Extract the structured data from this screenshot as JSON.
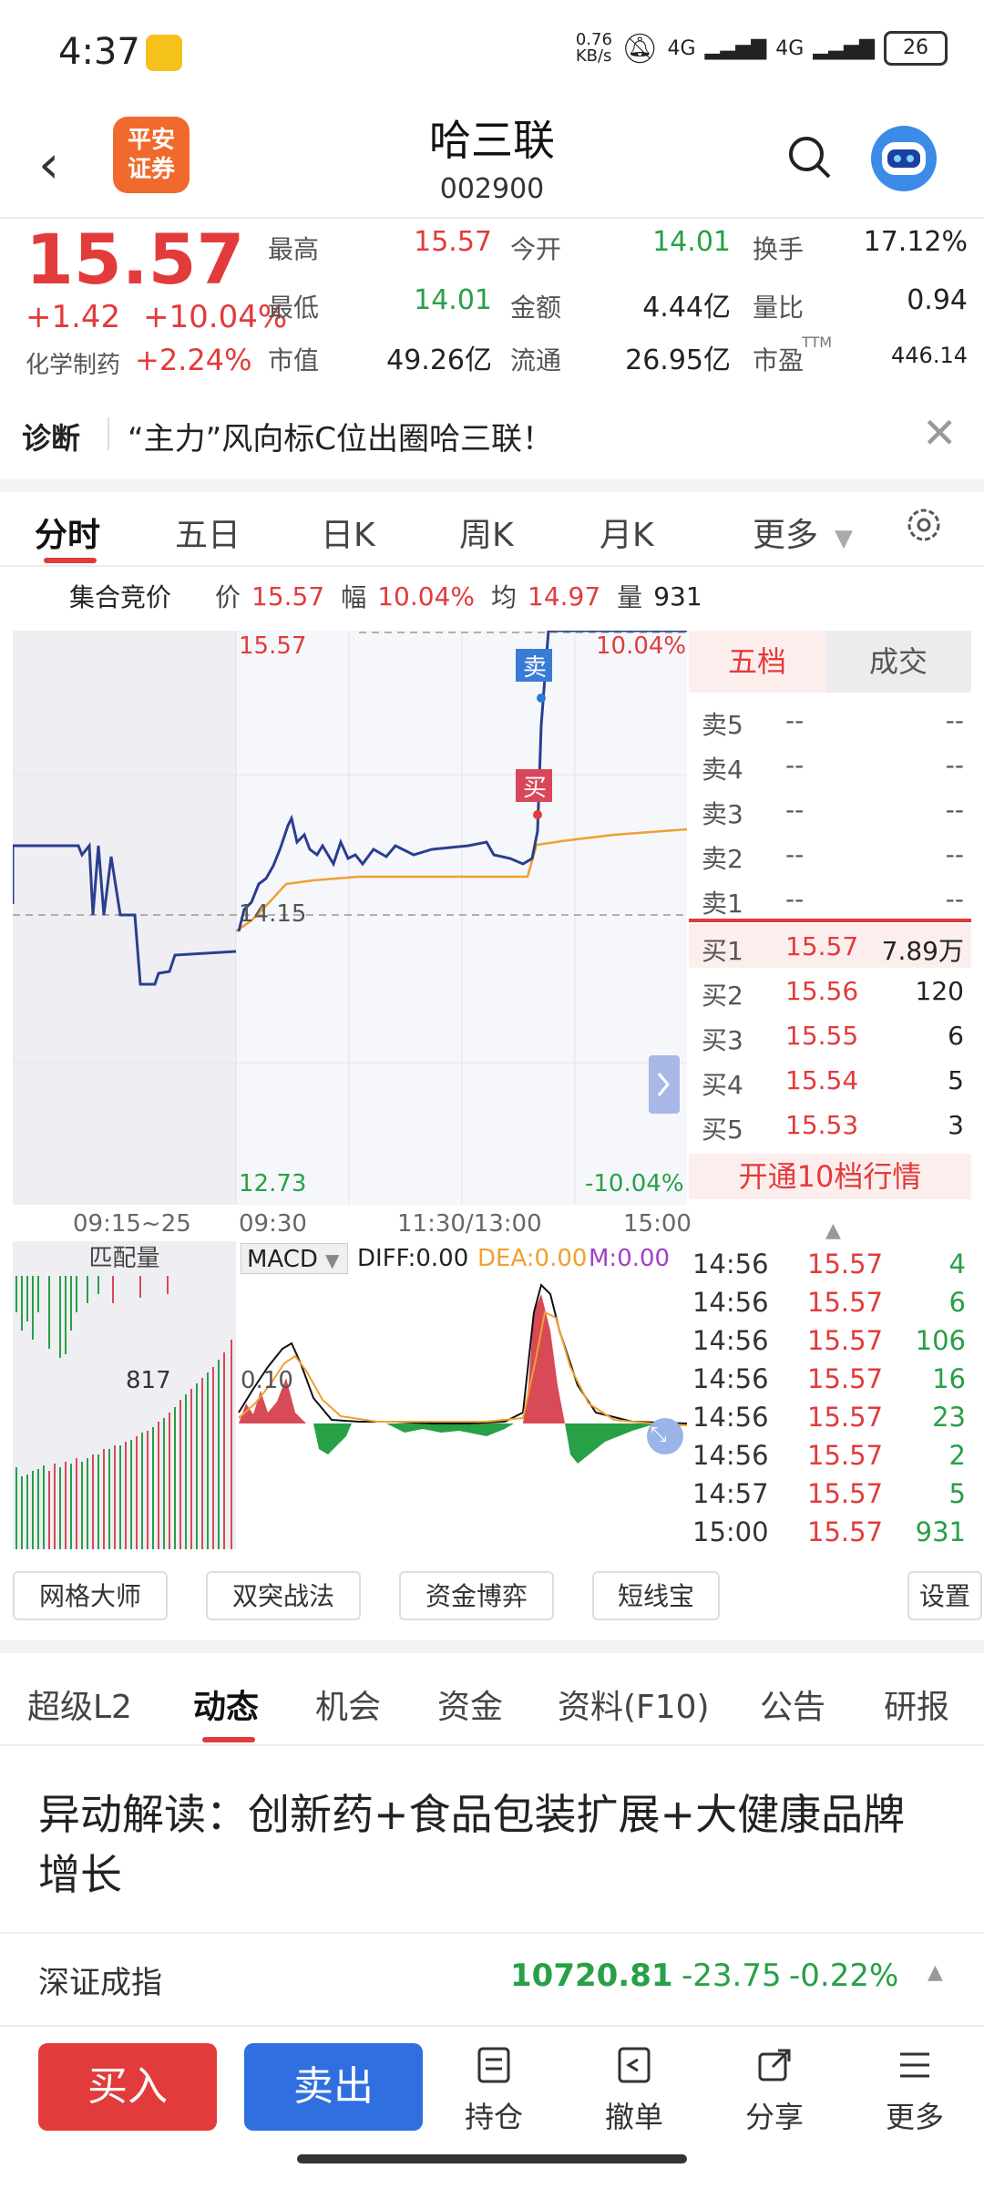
{
  "status_bar": {
    "time": "4:37",
    "speed": "0.76\nKB/s",
    "net1": "4G",
    "net2": "4G",
    "battery": "26"
  },
  "header": {
    "back": "‹",
    "logo_line1": "平安",
    "logo_line2": "证券",
    "name": "哈三联",
    "code": "002900"
  },
  "quote": {
    "price": "15.57",
    "change": "+1.42",
    "change_pct": "+10.04%",
    "sector": "化学制药",
    "sector_pct": "+2.24%",
    "cells": [
      {
        "label": "最高",
        "value": "15.57",
        "color": "#e23b3b"
      },
      {
        "label": "今开",
        "value": "14.01",
        "color": "#27a046"
      },
      {
        "label": "换手",
        "value": "17.12%",
        "color": "#222222"
      },
      {
        "label": "最低",
        "value": "14.01",
        "color": "#27a046"
      },
      {
        "label": "金额",
        "value": "4.44亿",
        "color": "#222222"
      },
      {
        "label": "量比",
        "value": "0.94",
        "color": "#222222"
      },
      {
        "label": "市值",
        "value": "49.26亿",
        "color": "#222222"
      },
      {
        "label": "流通",
        "value": "26.95亿",
        "color": "#222222"
      },
      {
        "label": "市盈",
        "value": "446.14",
        "color": "#222222"
      }
    ],
    "ttm": "TTM"
  },
  "diagnosis": {
    "label": "诊断",
    "text": "“主力”风向标C位出圈哈三联！",
    "close": "✕"
  },
  "tabs": {
    "items": [
      "分时",
      "五日",
      "日K",
      "周K",
      "月K",
      "更多"
    ],
    "active": "分时"
  },
  "info_strip": {
    "auction": "集合竞价",
    "p_label": "价",
    "p": "15.57",
    "f_label": "幅",
    "f": "10.04%",
    "avg_label": "均",
    "avg": "14.97",
    "vol_label": "量",
    "vol": "931"
  },
  "chart": {
    "high_label": "15.57",
    "high_pct": "10.04%",
    "mid_label": "14.15",
    "low_label": "12.73",
    "low_pct": "-10.04%",
    "sell_marker": "卖",
    "buy_marker": "买",
    "time_axis": [
      "09:15~25",
      "09:30",
      "11:30/13:00",
      "15:00"
    ],
    "match_label": "匹配量",
    "match_value": "817",
    "macd": {
      "indicator": "MACD",
      "diff": "DIFF:0.00",
      "dea": "DEA:0.00",
      "m": "M:0.00",
      "level": "0.10"
    }
  },
  "order_book": {
    "tab_left": "五档",
    "tab_right": "成交",
    "asks": [
      {
        "label": "卖5",
        "price": "--",
        "vol": "--"
      },
      {
        "label": "卖4",
        "price": "--",
        "vol": "--"
      },
      {
        "label": "卖3",
        "price": "--",
        "vol": "--"
      },
      {
        "label": "卖2",
        "price": "--",
        "vol": "--"
      },
      {
        "label": "卖1",
        "price": "--",
        "vol": "--"
      }
    ],
    "bids": [
      {
        "label": "买1",
        "price": "15.57",
        "vol": "7.89万"
      },
      {
        "label": "买2",
        "price": "15.56",
        "vol": "120"
      },
      {
        "label": "买3",
        "price": "15.55",
        "vol": "6"
      },
      {
        "label": "买4",
        "price": "15.54",
        "vol": "5"
      },
      {
        "label": "买5",
        "price": "15.53",
        "vol": "3"
      }
    ],
    "promo": "开通10档行情"
  },
  "ticks": [
    {
      "time": "14:56",
      "price": "15.57",
      "vol": "4"
    },
    {
      "time": "14:56",
      "price": "15.57",
      "vol": "6"
    },
    {
      "time": "14:56",
      "price": "15.57",
      "vol": "106"
    },
    {
      "time": "14:56",
      "price": "15.57",
      "vol": "16"
    },
    {
      "time": "14:56",
      "price": "15.57",
      "vol": "23"
    },
    {
      "time": "14:56",
      "price": "15.57",
      "vol": "2"
    },
    {
      "time": "14:57",
      "price": "15.57",
      "vol": "5"
    },
    {
      "time": "15:00",
      "price": "15.57",
      "vol": "931"
    }
  ],
  "strategies": [
    "网格大师",
    "双突战法",
    "资金博弈",
    "短线宝",
    "设置"
  ],
  "subtabs": {
    "items": [
      "超级L2",
      "动态",
      "机会",
      "资金",
      "资料(F10)",
      "公告",
      "研报"
    ],
    "active": "动态"
  },
  "news": {
    "title": "异动解读：创新药+食品包装扩展+大健康品牌增长"
  },
  "index": {
    "name": "深证成指",
    "value": "10720.81",
    "change": "-23.75",
    "pct": "-0.22%"
  },
  "bottom": {
    "buy": "买入",
    "sell": "卖出",
    "items": [
      "持仓",
      "撤单",
      "分享",
      "更多"
    ]
  },
  "colors": {
    "up": "#e23b3b",
    "down": "#27a046",
    "price_line": "#2a3f8f",
    "avg_line": "#f0a030",
    "sell_button": "#2f6fe0"
  }
}
